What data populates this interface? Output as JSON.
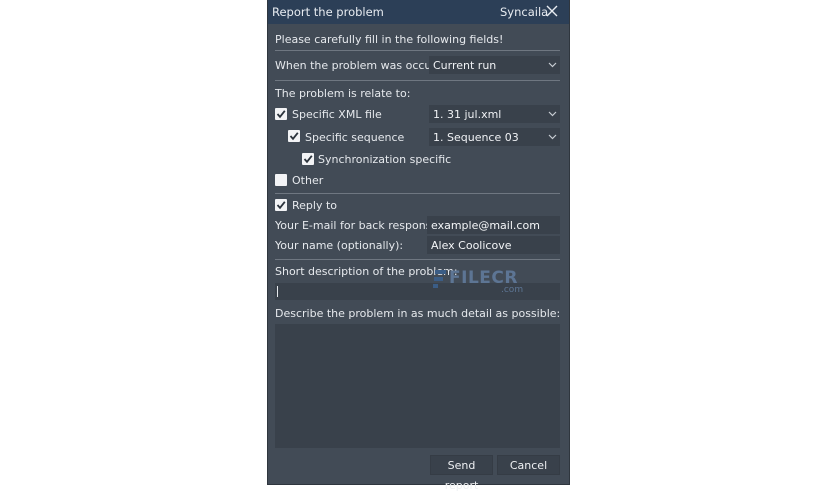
{
  "window": {
    "title": "Report the problem",
    "app_name": "Syncaila"
  },
  "intro": "Please carefully fill in the following fields!",
  "occur": {
    "label": "When the problem was occur?",
    "value": "Current run"
  },
  "relate": {
    "label": "The problem is relate to:",
    "xml_file": {
      "label": "Specific XML file",
      "checked": true,
      "value": "1. 31 jul.xml"
    },
    "sequence": {
      "label": "Specific sequence",
      "checked": true,
      "value": "1. Sequence 03"
    },
    "sync": {
      "label": "Synchronization specific",
      "checked": true
    },
    "other": {
      "label": "Other",
      "checked": false
    }
  },
  "reply": {
    "label": "Reply to",
    "checked": true,
    "email_label": "Your E-mail for back response:",
    "email_value": "example@mail.com",
    "name_label": "Your name (optionally):",
    "name_value": "Alex Coolicove"
  },
  "short_desc": {
    "label": "Short description of the problem:",
    "value": ""
  },
  "detail_desc": {
    "label": "Describe the problem in as much detail as possible:",
    "value": ""
  },
  "buttons": {
    "send": "Send report",
    "cancel": "Cancel"
  },
  "watermark": {
    "text": "FILECR",
    "suffix": ".com"
  },
  "colors": {
    "dialog_bg": "#424b56",
    "titlebar_bg": "#2c3f57",
    "field_bg": "#39414b",
    "text": "#e6e9ed"
  }
}
